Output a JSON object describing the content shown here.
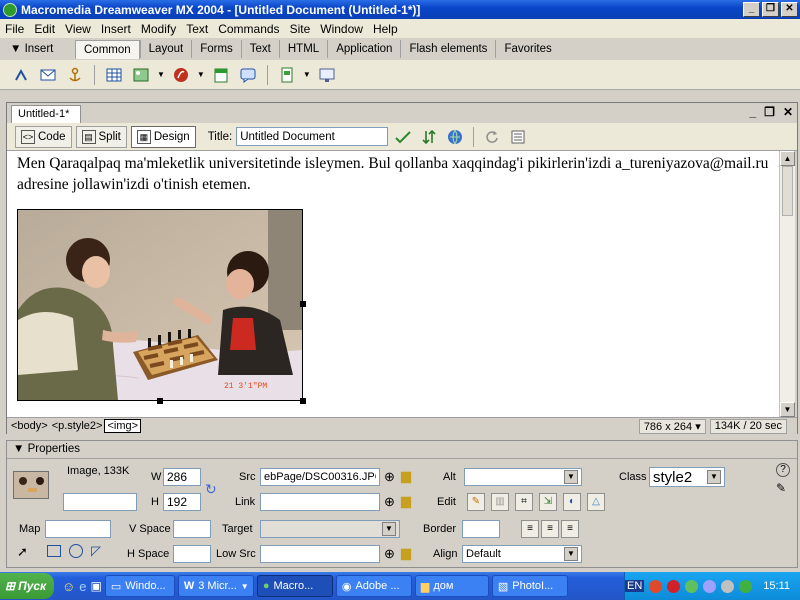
{
  "window": {
    "title": "Macromedia Dreamweaver MX 2004 - [Untitled Document (Untitled-1*)]"
  },
  "menu": [
    "File",
    "Edit",
    "View",
    "Insert",
    "Modify",
    "Text",
    "Commands",
    "Site",
    "Window",
    "Help"
  ],
  "insert_bar": {
    "title": "Insert",
    "tabs": [
      "Common",
      "Layout",
      "Forms",
      "Text",
      "HTML",
      "Application",
      "Flash elements",
      "Favorites"
    ],
    "selected_tab": "Common",
    "icons": [
      "hyperlink-icon",
      "email-link-icon",
      "named-anchor-icon",
      "table-icon",
      "image-icon",
      "media-icon",
      "date-icon",
      "comment-icon",
      "templates-icon",
      "tag-chooser-icon"
    ]
  },
  "document": {
    "tab": "Untitled-1*",
    "views": {
      "code": "Code",
      "split": "Split",
      "design": "Design"
    },
    "title_label": "Title:",
    "title_value": "Untitled Document",
    "body_text": "Men Qaraqalpaq ma'mleketlik universitetinde isleymen. Bul qollanba xaqqindag'i pikirlerin'izdi a_tureniyazova@mail.ru adresine jollawin'izdi o'tinish etemen.",
    "photo_caption": "21 3'1\"PM",
    "status": {
      "tags": [
        "<body>",
        "<p.style2>",
        "<img>"
      ],
      "selected_tag": "<img>",
      "dimensions": "786 x 264",
      "size": "134K / 20 sec"
    }
  },
  "properties": {
    "title": "Properties",
    "image_type": "Image, 133K",
    "w_label": "W",
    "w_value": "286",
    "h_label": "H",
    "h_value": "192",
    "src_label": "Src",
    "src_value": "ebPage/DSC00316.JPG",
    "link_label": "Link",
    "link_value": "",
    "alt_label": "Alt",
    "alt_value": "",
    "edit_label": "Edit",
    "class_label": "Class",
    "class_value": "style2",
    "map_label": "Map",
    "vspace_label": "V Space",
    "hspace_label": "H Space",
    "target_label": "Target",
    "lowsrc_label": "Low Src",
    "border_label": "Border",
    "align_label": "Align",
    "align_value": "Default"
  },
  "taskbar": {
    "start": "Пуск",
    "buttons": [
      {
        "label": "Windo...",
        "icon": "window-icon"
      },
      {
        "label": "3 Micr...",
        "icon": "word-icon"
      },
      {
        "label": "Macro...",
        "icon": "dreamweaver-icon",
        "active": true
      },
      {
        "label": "Adobe ...",
        "icon": "adobe-icon"
      },
      {
        "label": "дом",
        "icon": "folder-icon"
      },
      {
        "label": "PhotoI...",
        "icon": "photo-icon"
      }
    ],
    "lang": "EN",
    "clock": "15:11"
  },
  "colors": {
    "titlebar": "#0a46c9",
    "taskbar": "#245edb",
    "start": "#3a9a36"
  }
}
